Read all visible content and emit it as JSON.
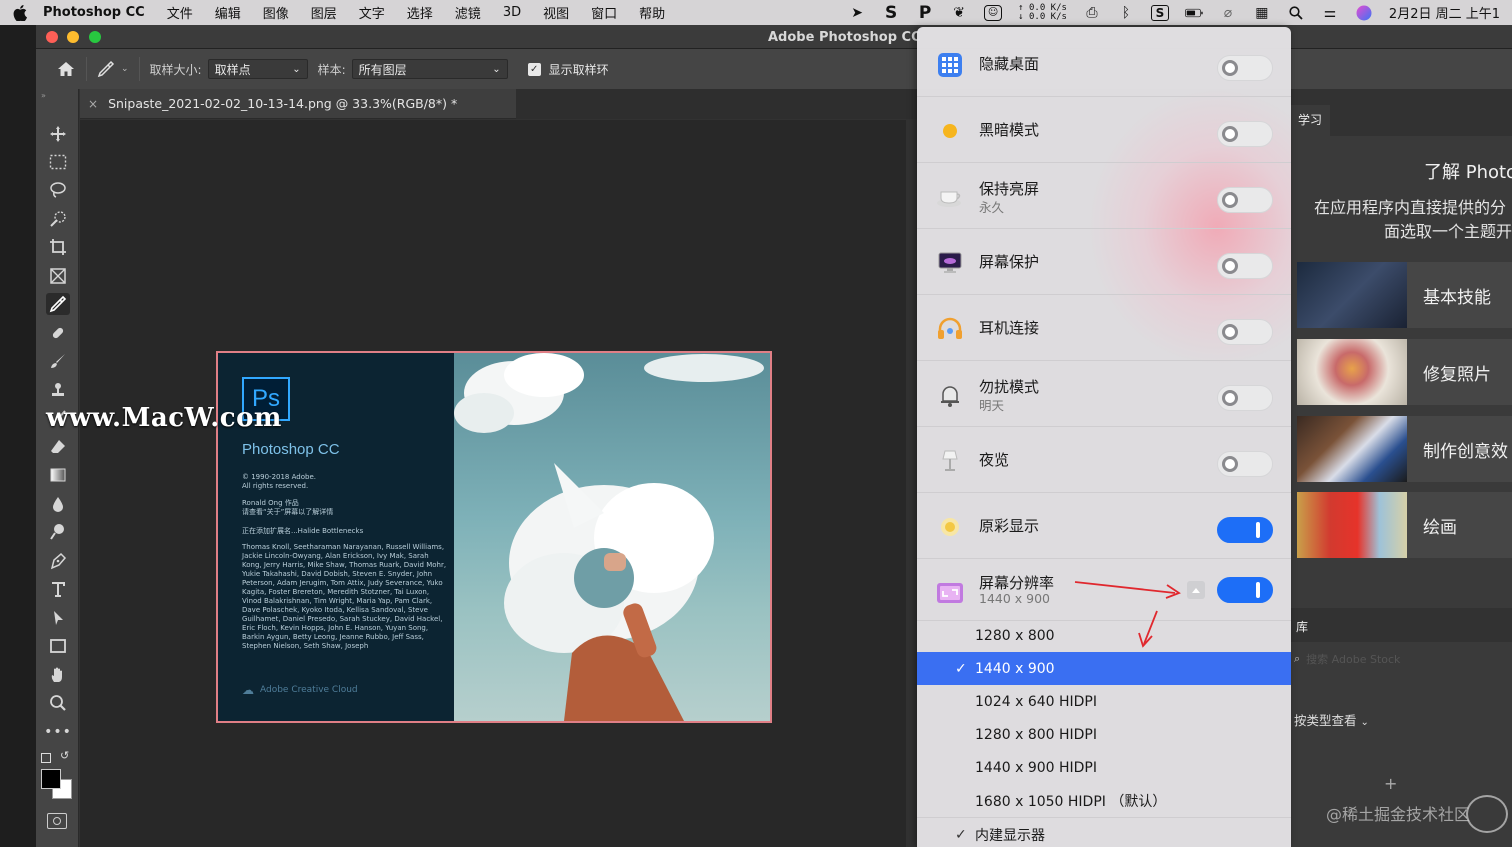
{
  "menubar": {
    "app_name": "Photoshop CC",
    "items": [
      "文件",
      "编辑",
      "图像",
      "图层",
      "文字",
      "选择",
      "滤镜",
      "3D",
      "视图",
      "窗口",
      "帮助"
    ],
    "net_up": "↑ 0.0 K/s",
    "net_down": "↓ 0.0 K/s",
    "clock": "2月2日 周二 上午1"
  },
  "window": {
    "title": "Adobe Photoshop CC"
  },
  "options_bar": {
    "sample_size_label": "取样大小:",
    "sample_size_value": "取样点",
    "sample_label": "样本:",
    "sample_value": "所有图层",
    "show_ring_label": "显示取样环"
  },
  "document": {
    "tab_title": "Snipaste_2021-02-02_10-13-14.png @ 33.3%(RGB/8*) *"
  },
  "splash": {
    "logo": "Ps",
    "product": "Photoshop CC",
    "copyright1": "© 1990-2018 Adobe.",
    "copyright2": "All rights reserved.",
    "artwork1": "Ronald Ong 作品",
    "artwork2": "请查看“关于”屏幕以了解详情",
    "loading": "正在添加扩展名...Halide Bottlenecks",
    "credits": "Thomas Knoll, Seetharaman Narayanan, Russell Williams, Jackie Lincoln-Owyang, Alan Erickson, Ivy Mak, Sarah Kong, Jerry Harris, Mike Shaw, Thomas Ruark, David Mohr, Yukie Takahashi, David Dobish, Steven E. Snyder, John Peterson, Adam Jerugim, Tom Attix, Judy Severance, Yuko Kagita, Foster Brereton, Meredith Stotzner, Tai Luxon, Vinod Balakrishnan, Tim Wright, Maria Yap, Pam Clark, Dave Polaschek, Kyoko Itoda, Kellisa Sandoval, Steve Guilhamet, Daniel Presedo, Sarah Stuckey, David Hackel, Eric Floch, Kevin Hopps, John E. Hanson, Yuyan Song, Barkin Aygun, Betty Leong, Jeanne Rubbo, Jeff Sass, Stephen Nielson, Seth Shaw, Joseph",
    "cc_label": "Adobe Creative Cloud"
  },
  "watermark_left": "www.MacW.com",
  "watermark_right": "@稀土掘金技术社区",
  "learn_panel": {
    "tab": "学习",
    "heading": "了解 Photo",
    "desc1": "在应用程序内直接提供的分",
    "desc2": "面选取一个主题开",
    "cards": [
      {
        "label": "基本技能"
      },
      {
        "label": "修复照片"
      },
      {
        "label": "制作创意效"
      },
      {
        "label": "绘画"
      }
    ],
    "library_tab": "库",
    "search_placeholder": "搜索 Adobe Stock",
    "view_by_type": "按类型查看"
  },
  "dropdown": {
    "toggles": [
      {
        "label": "隐藏桌面",
        "sub": "",
        "on": false,
        "icon": "grid-icon"
      },
      {
        "label": "黑暗模式",
        "sub": "",
        "on": false,
        "icon": "sun-icon"
      },
      {
        "label": "保持亮屏",
        "sub": "永久",
        "on": false,
        "icon": "coffee-cup-icon"
      },
      {
        "label": "屏幕保护",
        "sub": "",
        "on": false,
        "icon": "monitor-icon"
      },
      {
        "label": "耳机连接",
        "sub": "",
        "on": false,
        "icon": "headphones-icon"
      },
      {
        "label": "勿扰模式",
        "sub": "明天",
        "on": false,
        "icon": "bell-icon"
      },
      {
        "label": "夜览",
        "sub": "",
        "on": false,
        "icon": "lamp-icon"
      },
      {
        "label": "原彩显示",
        "sub": "",
        "on": true,
        "icon": "true-tone-icon"
      },
      {
        "label": "屏幕分辨率",
        "sub": "1440 x 900",
        "on": true,
        "icon": "resolution-icon"
      }
    ],
    "resolutions": [
      "1280 x 800",
      "1440 x 900",
      "1024 x 640 HIDPI",
      "1280 x 800 HIDPI",
      "1440 x 900 HIDPI",
      "1680 x 1050 HIDPI （默认）"
    ],
    "selected_resolution": "1440 x 900",
    "builtin_display": "内建显示器",
    "check_mark": "✓"
  },
  "colors": {
    "toggle_on": "#1d6ef7",
    "selection": "#3a6ff2",
    "annotation_arrow": "#e0282e",
    "splash_border": "#e07f86"
  }
}
